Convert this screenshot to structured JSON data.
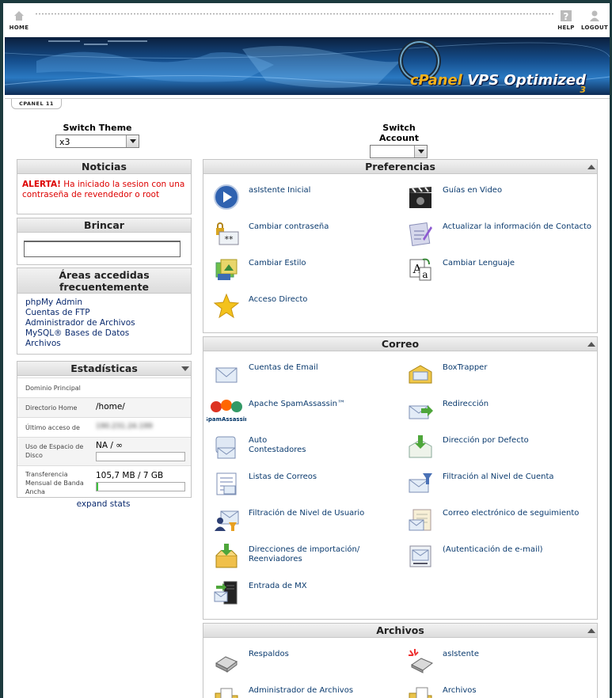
{
  "topbar": {
    "home": "HOME",
    "help": "HELP",
    "logout": "LOGOUT"
  },
  "banner": {
    "brand_prefix": "cPanel",
    "brand_suffix": " VPS Optimized",
    "version": "3"
  },
  "subtab": "CPANEL 11",
  "switch_theme": {
    "label": "Switch Theme",
    "value": "x3"
  },
  "switch_account": {
    "label": "Switch Account",
    "value": ""
  },
  "noticias": {
    "title": "Noticias",
    "alert_prefix": "ALERTA!",
    "alert_text": " Ha iniciado la sesion con una contraseña de revendedor o root"
  },
  "brincar": {
    "title": "Brincar",
    "value": ""
  },
  "areas": {
    "title": "Áreas accedidas frecuentemente",
    "links": [
      "phpMy Admin",
      "Cuentas de FTP",
      "Administrador de Archivos",
      "MySQL® Bases de Datos",
      "Archivos"
    ]
  },
  "stats": {
    "title": "Estadísticas",
    "rows": [
      {
        "label": "Dominio Principal",
        "value": ""
      },
      {
        "label": "Directorio Home",
        "value": "/home/"
      },
      {
        "label": "Último acceso de",
        "value": "190.231.24.199"
      },
      {
        "label": "Uso de Espacio de Disco",
        "value": "NA / ∞"
      },
      {
        "label": "Transferencia Mensual de Banda Ancha",
        "value": "105,7 MB / 7 GB"
      }
    ],
    "disk_fill": 0,
    "bandwidth_fill": 0.015,
    "expand": "expand stats"
  },
  "preferencias": {
    "title": "Preferencias",
    "items": [
      "asIstente Inicial",
      "Guías en Video",
      "Cambiar contraseña",
      "Actualizar la información de Contacto",
      "Cambiar Estilo",
      "Cambiar Lenguaje",
      "Acceso Directo"
    ]
  },
  "correo": {
    "title": "Correo",
    "items": [
      "Cuentas de Email",
      "BoxTrapper",
      "Apache SpamAssassin™",
      "Redirección",
      "Auto\nContestadores",
      "Dirección por Defecto",
      "Listas de Correos",
      "Filtración al Nivel de Cuenta",
      "Filtración de Nivel de Usuario",
      "Correo electrónico de seguimiento",
      "Direcciones de importación/\nReenviadores",
      "(Autenticación de e-mail)",
      "Entrada de MX"
    ],
    "spam_logo_text": "SpamAssassin"
  },
  "archivos": {
    "title": "Archivos",
    "items": [
      "Respaldos",
      "asIstente",
      "Administrador de Archivos",
      "Archivos"
    ]
  }
}
